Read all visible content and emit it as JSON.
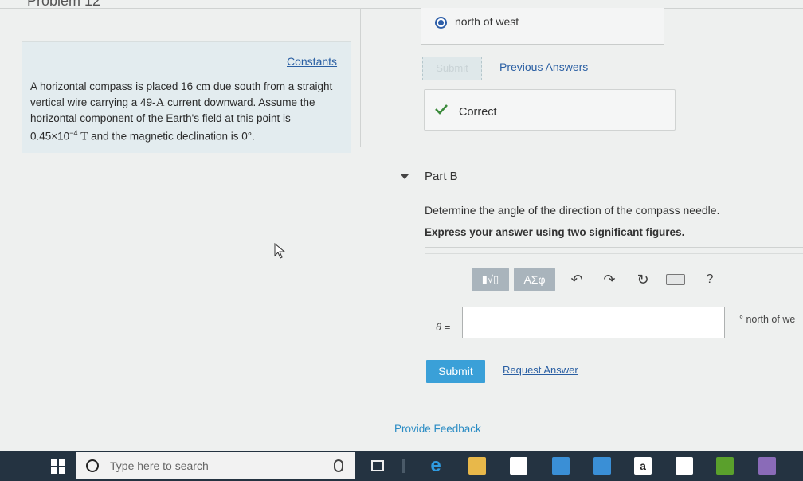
{
  "page": {
    "title": "Problem 12"
  },
  "left_panel": {
    "constants_label": "Constants",
    "problem_text": {
      "p1": "A horizontal compass is placed 16 ",
      "u1": "cm",
      "p2": " due south from a straight vertical wire carrying a 49-",
      "u2": "A",
      "p3": " current downward. Assume the horizontal component of the Earth's field at this point is 0.45×10",
      "exp": "−4",
      "p4": " ",
      "u3": "T",
      "p5": " and the magnetic declination is 0°."
    }
  },
  "part_a": {
    "selected_option": "north of west",
    "submit_label": "Submit",
    "previous_answers_label": "Previous Answers",
    "result_label": "Correct"
  },
  "part_b": {
    "label": "Part B",
    "question": "Determine the angle of the direction of the compass needle.",
    "instruction": "Express your answer using two significant figures.",
    "toolbar": {
      "templates_label": "▮√▯",
      "greek_label": "ΑΣφ",
      "undo_glyph": "↶",
      "redo_glyph": "↷",
      "reset_glyph": "↻",
      "help_glyph": "?"
    },
    "variable_label": "θ =",
    "answer_value": "",
    "unit_label": "° north of we",
    "submit_label": "Submit",
    "request_answer_label": "Request Answer"
  },
  "feedback_label": "Provide Feedback",
  "taskbar": {
    "search_placeholder": "Type here to search",
    "amazon_glyph": "a",
    "edge_glyph": "e"
  },
  "colors": {
    "accent_blue": "#3aa0d8",
    "link_blue": "#2a5fa3",
    "correct_green": "#3c8b3c",
    "taskbar": "#243341"
  }
}
